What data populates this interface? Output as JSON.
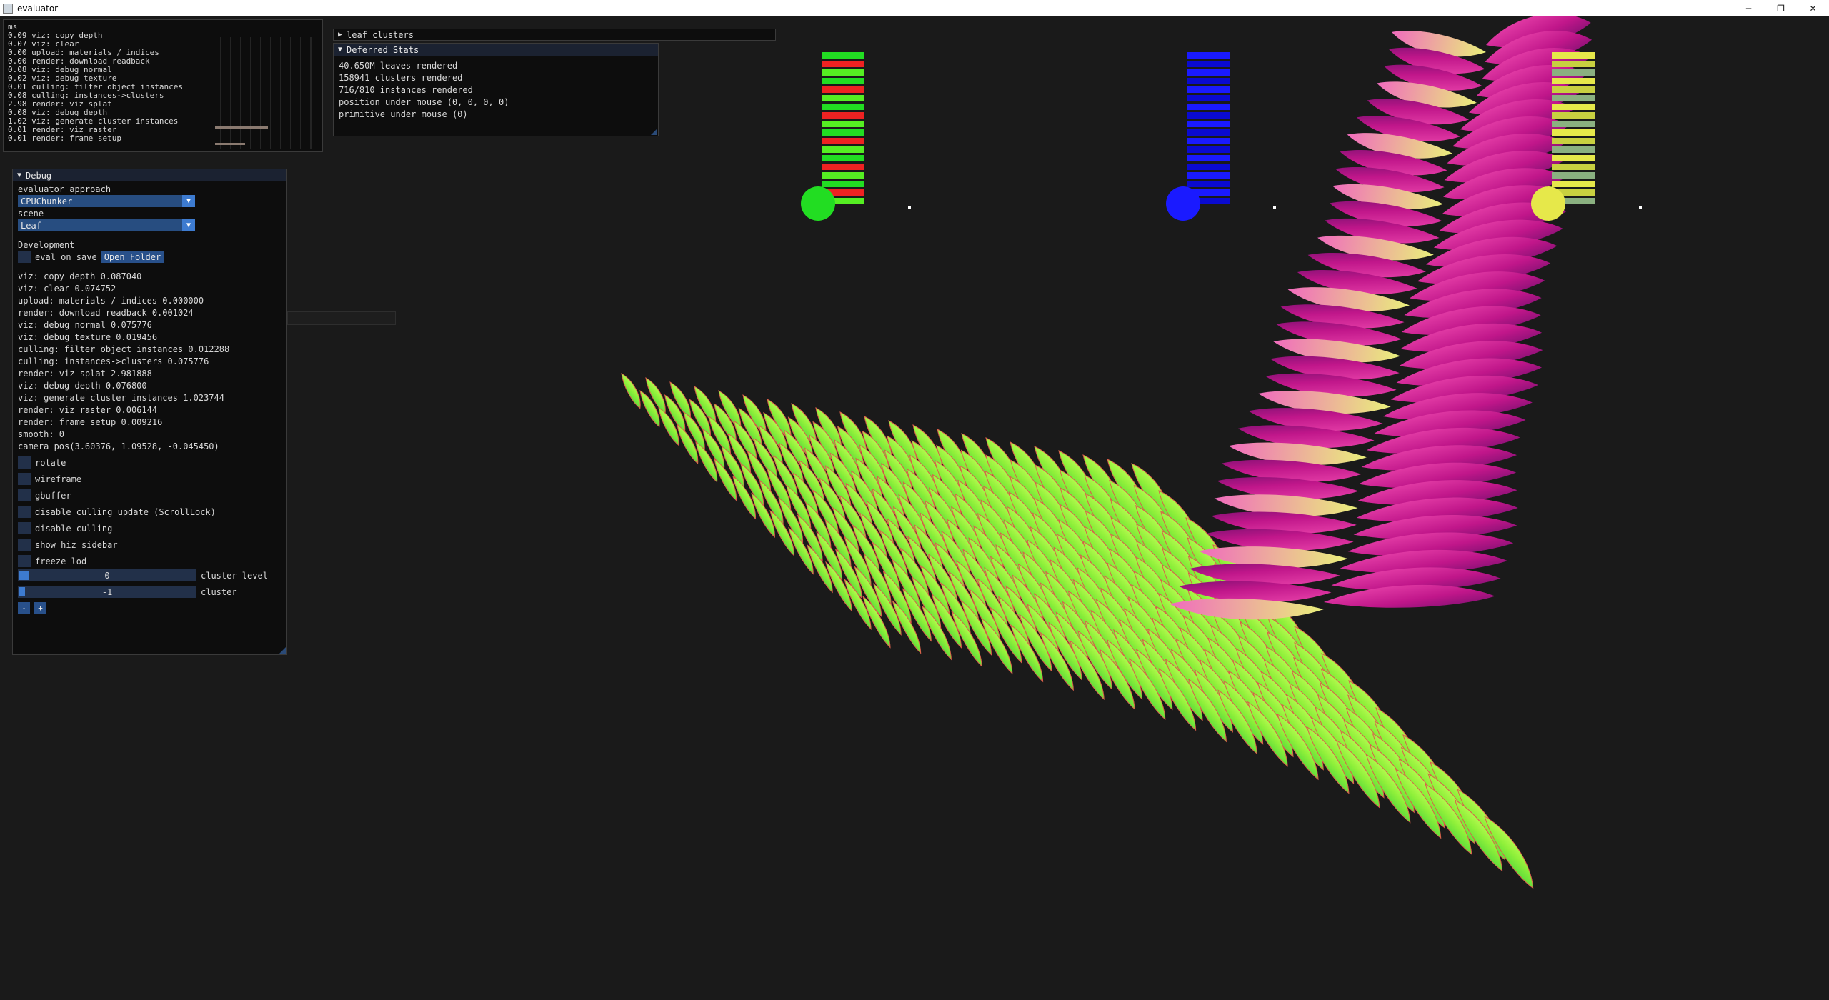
{
  "window": {
    "title": "evaluator",
    "controls": [
      "─",
      "❐",
      "✕"
    ]
  },
  "profiler": {
    "header": "ms",
    "lines": [
      "0.09 viz: copy depth",
      "0.07 viz: clear",
      "0.00 upload: materials / indices",
      "0.00 render: download readback",
      "0.08 viz: debug normal",
      "0.02 viz: debug texture",
      "0.01 culling: filter object instances",
      "0.08 culling: instances->clusters",
      "2.98 render: viz splat",
      "0.08 viz: debug depth",
      "1.02 viz: generate cluster instances",
      "0.01 render: viz raster",
      "0.01 render: frame setup"
    ]
  },
  "leaf_clusters": {
    "label": "leaf clusters",
    "arrow": "▶"
  },
  "deferred": {
    "title": "Deferred Stats",
    "arrow": "▼",
    "lines": [
      "40.650M leaves rendered",
      "158941 clusters rendered",
      "716/810 instances rendered",
      "position under mouse (0, 0, 0, 0)",
      "primitive under mouse (0)"
    ]
  },
  "debug": {
    "title": "Debug",
    "arrow": "▼",
    "approach_label": "evaluator approach",
    "approach_value": "CPUChunker",
    "scene_label": "scene",
    "scene_value": "Leaf",
    "dev_label": "Development",
    "eval_on_save": "eval on save",
    "open_folder": "Open Folder",
    "timings": [
      "viz: copy depth 0.087040",
      "viz: clear 0.074752",
      "upload: materials / indices 0.000000",
      "render: download readback 0.001024",
      "viz: debug normal 0.075776",
      "viz: debug texture 0.019456",
      "culling: filter object instances 0.012288",
      "culling: instances->clusters 0.075776",
      "render: viz splat 2.981888",
      "viz: debug depth 0.076800",
      "viz: generate cluster instances 1.023744",
      "render: viz raster 0.006144",
      "render: frame setup 0.009216"
    ],
    "smooth": "smooth: 0",
    "camera": "camera pos(3.60376, 1.09528, -0.045450)",
    "checkboxes": [
      "rotate",
      "wireframe",
      "gbuffer",
      "disable culling update (ScrollLock)",
      "disable culling",
      "show hiz sidebar",
      "freeze lod"
    ],
    "cluster_level": {
      "value": "0",
      "label": "cluster level"
    },
    "cluster": {
      "value": "-1",
      "label": "cluster"
    },
    "minus": "-",
    "plus": "+"
  },
  "colors": {
    "panel_bg": "#0d0d0d",
    "header_bg": "#1b2231",
    "frame_bg": "#223049",
    "button": "#28508a",
    "accent": "#3d7bd0",
    "leaf_green": "#9bf53a",
    "leaf_magenta": "#d21e8c"
  }
}
